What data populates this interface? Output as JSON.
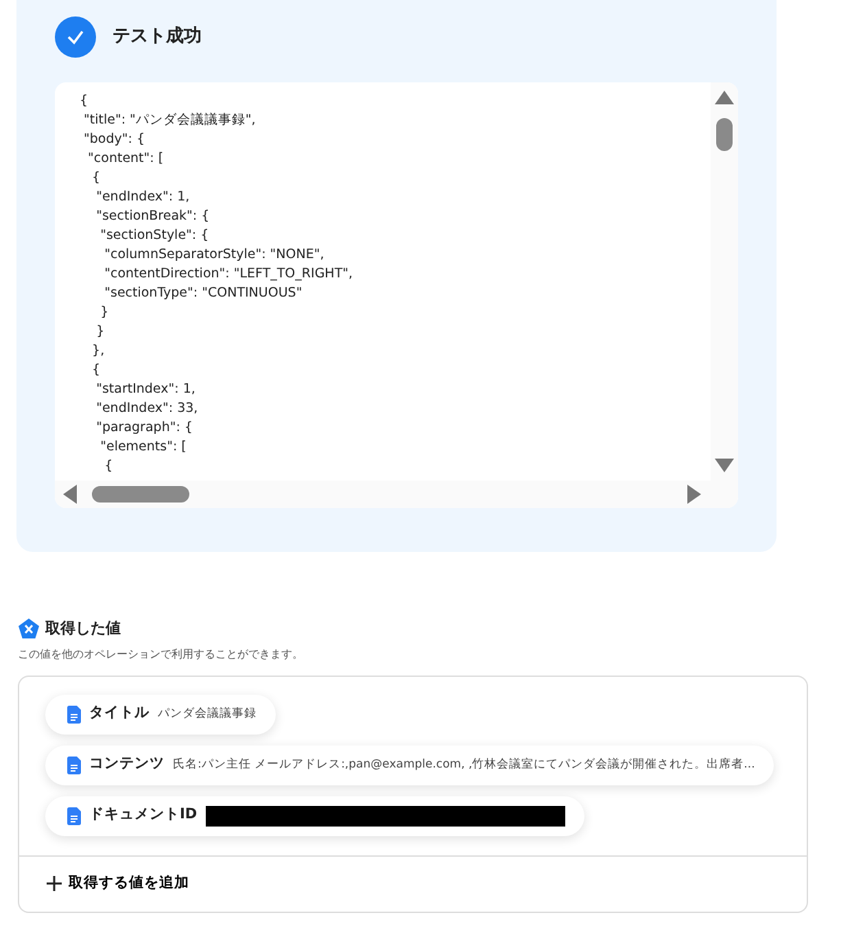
{
  "test_result": {
    "passed": true,
    "label": "テスト成功"
  },
  "code_lines": [
    "{",
    " \"title\": \"パンダ会議議事録\",",
    " \"body\": {",
    "  \"content\": [",
    "   {",
    "    \"endIndex\": 1,",
    "    \"sectionBreak\": {",
    "     \"sectionStyle\": {",
    "      \"columnSeparatorStyle\": \"NONE\",",
    "      \"contentDirection\": \"LEFT_TO_RIGHT\",",
    "      \"sectionType\": \"CONTINUOUS\"",
    "     }",
    "    }",
    "   },",
    "   {",
    "    \"startIndex\": 1,",
    "    \"endIndex\": 33,",
    "    \"paragraph\": {",
    "     \"elements\": [",
    "      {"
  ],
  "retrieved": {
    "heading": "取得した値",
    "description": "この値を他のオペレーションで利用することができます。",
    "values": [
      {
        "label": "タイトル",
        "value": "パンダ会議議事録",
        "redacted": false
      },
      {
        "label": "コンテンツ",
        "value": "氏名:パン主任 メールアドレス:,pan@example.com, ,竹林会議室にてパンダ会議が開催された。出席者...",
        "redacted": false
      },
      {
        "label": "ドキュメントID",
        "redacted": true
      }
    ],
    "add_button": "取得する値を追加"
  }
}
